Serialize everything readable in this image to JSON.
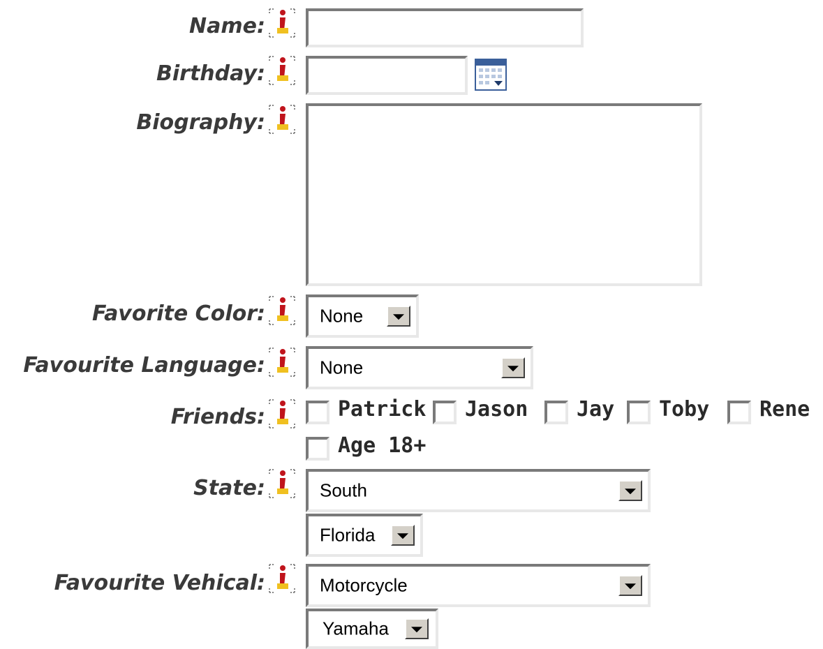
{
  "fields": {
    "name": {
      "label": "Name:",
      "value": ""
    },
    "birthday": {
      "label": "Birthday:",
      "value": ""
    },
    "biography": {
      "label": "Biography:",
      "value": ""
    },
    "favorite_color": {
      "label": "Favorite Color:",
      "selected": "None"
    },
    "favourite_language": {
      "label": "Favourite Language:",
      "selected": "None"
    },
    "friends": {
      "label": "Friends:",
      "options": [
        "Patrick",
        "Jason",
        "Jay",
        "Toby",
        "Rene"
      ],
      "checked": [
        false,
        false,
        false,
        false,
        false
      ]
    },
    "age": {
      "label": "Age 18+",
      "checked": false
    },
    "state": {
      "label": "State:",
      "region_selected": "South",
      "state_selected": "Florida"
    },
    "favourite_vehical": {
      "label": "Favourite Vehical:",
      "type_selected": "Motorcycle",
      "make_selected": "Yamaha"
    }
  },
  "icons": {
    "info": "info-icon",
    "calendar": "calendar-icon",
    "dropdown": "chevron-down-icon"
  },
  "colors": {
    "label_text": "#3a3a3a",
    "info_red": "#c0141c",
    "info_yellow": "#f0c020",
    "calendar_blue": "#3a5f9a"
  }
}
